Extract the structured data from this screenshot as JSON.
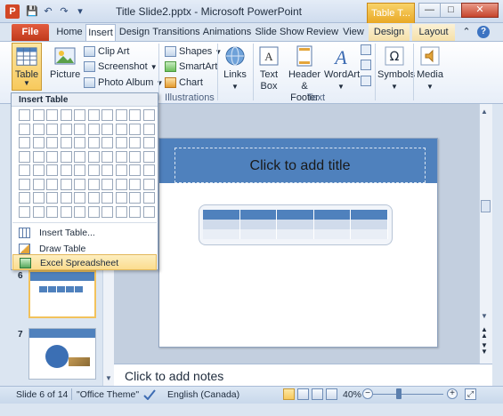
{
  "window": {
    "title": "Title Slide2.pptx - Microsoft PowerPoint",
    "context_tab_group": "Table T...",
    "app_icon": "P",
    "controls": {
      "minimize": "—",
      "maximize": "□",
      "close": "✕"
    }
  },
  "tabs": [
    {
      "label": "File"
    },
    {
      "label": "Home"
    },
    {
      "label": "Insert"
    },
    {
      "label": "Design"
    },
    {
      "label": "Transitions"
    },
    {
      "label": "Animations"
    },
    {
      "label": "Slide Show"
    },
    {
      "label": "Review"
    },
    {
      "label": "View"
    },
    {
      "label": "Design"
    },
    {
      "label": "Layout"
    }
  ],
  "ribbon": {
    "table": "Table",
    "picture": "Picture",
    "clip_art": "Clip Art",
    "screenshot": "Screenshot",
    "photo_album": "Photo Album",
    "shapes": "Shapes",
    "smartart": "SmartArt",
    "chart": "Chart",
    "links": "Links",
    "text_box": "Text Box",
    "header_footer": "Header & Footer",
    "wordart": "WordArt",
    "symbols": "Symbols",
    "media": "Media",
    "group_illustrations": "Illustrations",
    "group_text": "Text"
  },
  "dropdown": {
    "header": "Insert Table",
    "items": [
      "Insert Table...",
      "Draw Table",
      "Excel Spreadsheet"
    ]
  },
  "slides": {
    "thumb6_num": "6",
    "thumb7_num": "7"
  },
  "slide": {
    "title_placeholder": "Click to add title"
  },
  "notes": {
    "placeholder": "Click to add notes"
  },
  "status": {
    "slide_info": "Slide 6 of 14",
    "theme": "\"Office Theme\"",
    "language": "English (Canada)",
    "zoom": "40%",
    "zoom_value_percent": 40
  },
  "colors": {
    "accent_blue": "#4f81bd",
    "file_tab": "#c0391c",
    "context_tab": "#e9a825"
  }
}
